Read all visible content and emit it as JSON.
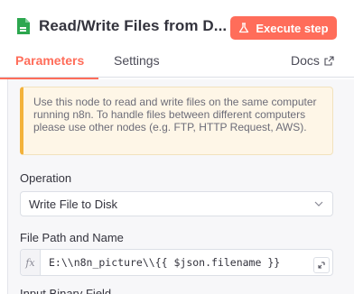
{
  "header": {
    "title": "Read/Write Files from D...",
    "execute_label": "Execute step",
    "colors": {
      "accent": "#ff6d5a",
      "node_icon": "#2da74f"
    }
  },
  "tabs": [
    {
      "label": "Parameters",
      "active": true
    },
    {
      "label": "Settings",
      "active": false
    },
    {
      "label": "Docs",
      "active": false,
      "icon": "external-link-icon"
    }
  ],
  "notice": {
    "text": "Use this node to read and write files on the same computer running n8n. To handle files between different computers please use other nodes (e.g. FTP, HTTP Request, AWS)."
  },
  "operation": {
    "label": "Operation",
    "value": "Write File to Disk"
  },
  "file_path": {
    "label": "File Path and Name",
    "fx": "fx",
    "expression": "E:\\\\n8n_picture\\\\{{ $json.filename }}"
  },
  "next_field": {
    "label": "Input Binary Field"
  }
}
